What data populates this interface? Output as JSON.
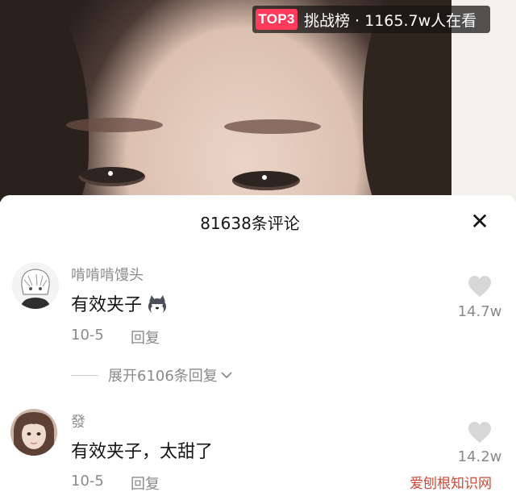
{
  "live": {
    "rank_badge": "TOP3",
    "status_text": "挑战榜 · 1165.7w人在看"
  },
  "comments_panel": {
    "title": "81638条评论",
    "close_icon": "close-icon"
  },
  "comments": [
    {
      "username": "啃啃啃馒头",
      "text": "有效夹子",
      "emoji_icon": "husky-dog-emoji-icon",
      "date": "10-5",
      "reply_label": "回复",
      "likes": "14.7w",
      "expand_replies": "展开6106条回复"
    },
    {
      "username": "發",
      "text": "有效夹子，太甜了",
      "date": "10-5",
      "reply_label": "回复",
      "likes": "14.2w"
    }
  ],
  "watermark": "爱刨根知识网"
}
